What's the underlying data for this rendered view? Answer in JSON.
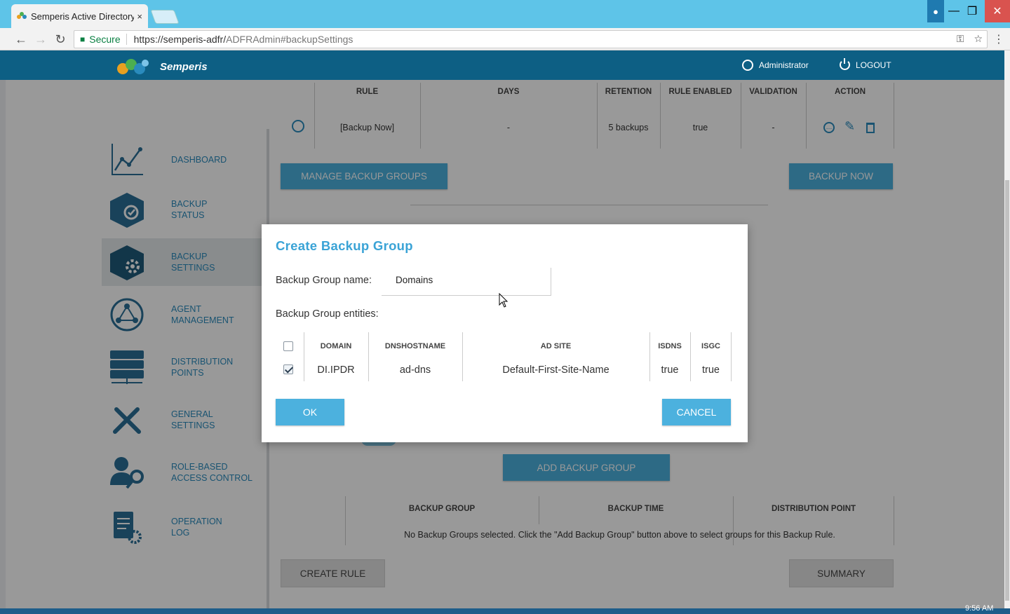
{
  "browser": {
    "tab_title": "Semperis Active Directory",
    "tab_close": "×",
    "secure_label": "Secure",
    "url_host": "https://semperis-adfr/",
    "url_path": "ADFRAdmin#backupSettings"
  },
  "header": {
    "brand": "Semperis",
    "user": "Administrator",
    "logout": "LOGOUT"
  },
  "sidebar": {
    "items": [
      {
        "label": "DASHBOARD",
        "icon": "chart-line-icon"
      },
      {
        "label": "BACKUP\nSTATUS",
        "icon": "backup-status-icon"
      },
      {
        "label": "BACKUP\nSETTINGS",
        "icon": "backup-settings-icon"
      },
      {
        "label": "AGENT\nMANAGEMENT",
        "icon": "globe-network-icon"
      },
      {
        "label": "DISTRIBUTION\nPOINTS",
        "icon": "server-icon"
      },
      {
        "label": "GENERAL\nSETTINGS",
        "icon": "tools-icon"
      },
      {
        "label": "ROLE-BASED\nACCESS CONTROL",
        "icon": "user-key-icon"
      },
      {
        "label": "OPERATION\nLOG",
        "icon": "document-gear-icon"
      }
    ]
  },
  "rules_table": {
    "headers": [
      "RULE",
      "DAYS",
      "RETENTION",
      "RULE ENABLED",
      "VALIDATION",
      "ACTION"
    ],
    "row": {
      "rule": "[Backup Now]",
      "days": "-",
      "retention": "5 backups",
      "enabled": "true",
      "validation": "-"
    }
  },
  "buttons": {
    "manage_groups": "MANAGE BACKUP GROUPS",
    "backup_now": "BACKUP NOW",
    "add_group": "ADD BACKUP GROUP",
    "create_rule": "CREATE RULE",
    "summary": "SUMMARY"
  },
  "groups_table": {
    "headers": [
      "BACKUP GROUP",
      "BACKUP TIME",
      "DISTRIBUTION POINT"
    ],
    "empty": "No Backup Groups selected. Click the \"Add Backup Group\" button above to select groups for this Backup Rule."
  },
  "modal": {
    "title": "Create Backup Group",
    "name_label": "Backup Group name:",
    "name_value": "Domains",
    "entities_label": "Backup Group entities:",
    "headers": [
      "DOMAIN",
      "DNSHOSTNAME",
      "AD SITE",
      "ISDNS",
      "ISGC"
    ],
    "row": {
      "domain": "DI.IPDR",
      "dnshostname": "ad-dns",
      "adsite": "Default-First-Site-Name",
      "isdns": "true",
      "isgc": "true",
      "checked": true
    },
    "ok": "OK",
    "cancel": "CANCEL"
  },
  "taskbar": {
    "time": "9:56 AM"
  },
  "colors": {
    "accent": "#4cb1de",
    "header": "#0d5f84",
    "tabbar": "#5ec4e8"
  }
}
